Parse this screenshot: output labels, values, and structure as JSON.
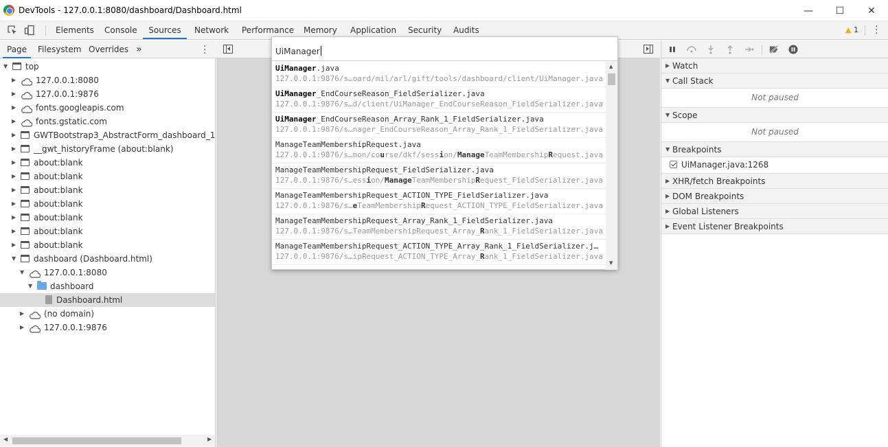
{
  "window": {
    "title": "DevTools - 127.0.0.1:8080/dashboard/Dashboard.html",
    "minimize": "—",
    "maximize": "☐",
    "close": "✕"
  },
  "toolbar": {
    "inspect_icon": "inspect-element-icon",
    "device_icon": "device-toolbar-icon",
    "tabs": [
      "Elements",
      "Console",
      "Sources",
      "Network",
      "Performance",
      "Memory",
      "Application",
      "Security",
      "Audits"
    ],
    "active_tab": "Sources",
    "warning_count": "1"
  },
  "navigator": {
    "tabs": [
      "Page",
      "Filesystem",
      "Overrides"
    ],
    "more": "»",
    "tree": [
      {
        "label": "top",
        "icon": "frame-icon",
        "expanded": true,
        "depth": 0
      },
      {
        "label": "127.0.0.1:8080",
        "icon": "cloud-icon",
        "expanded": false,
        "depth": 1
      },
      {
        "label": "127.0.0.1:9876",
        "icon": "cloud-icon",
        "expanded": false,
        "depth": 1
      },
      {
        "label": "fonts.googleapis.com",
        "icon": "cloud-icon",
        "expanded": false,
        "depth": 1
      },
      {
        "label": "fonts.gstatic.com",
        "icon": "cloud-icon",
        "expanded": false,
        "depth": 1
      },
      {
        "label": "GWTBootstrap3_AbstractForm_dashboard_1 (about:blank)",
        "icon": "frame-icon",
        "expanded": false,
        "depth": 1
      },
      {
        "label": "__gwt_historyFrame (about:blank)",
        "icon": "frame-icon",
        "expanded": false,
        "depth": 1
      },
      {
        "label": "about:blank",
        "icon": "frame-icon",
        "expanded": false,
        "depth": 1
      },
      {
        "label": "about:blank",
        "icon": "frame-icon",
        "expanded": false,
        "depth": 1
      },
      {
        "label": "about:blank",
        "icon": "frame-icon",
        "expanded": false,
        "depth": 1
      },
      {
        "label": "about:blank",
        "icon": "frame-icon",
        "expanded": false,
        "depth": 1
      },
      {
        "label": "about:blank",
        "icon": "frame-icon",
        "expanded": false,
        "depth": 1
      },
      {
        "label": "about:blank",
        "icon": "frame-icon",
        "expanded": false,
        "depth": 1
      },
      {
        "label": "about:blank",
        "icon": "frame-icon",
        "expanded": false,
        "depth": 1
      },
      {
        "label": "dashboard (Dashboard.html)",
        "icon": "frame-icon",
        "expanded": true,
        "depth": 1
      },
      {
        "label": "127.0.0.1:8080",
        "icon": "cloud-icon",
        "expanded": true,
        "depth": 2
      },
      {
        "label": "dashboard",
        "icon": "folder-icon",
        "expanded": true,
        "depth": 3
      },
      {
        "label": "Dashboard.html",
        "icon": "file-icon",
        "expanded": null,
        "depth": 4,
        "selected": true
      },
      {
        "label": "(no domain)",
        "icon": "cloud-icon",
        "expanded": false,
        "depth": 2
      },
      {
        "label": "127.0.0.1:9876",
        "icon": "cloud-icon",
        "expanded": false,
        "depth": 2
      }
    ]
  },
  "quick_open": {
    "query": "UiManager",
    "items": [
      {
        "name_html": "<b>UiManager</b>.java",
        "path_html": "127.0.0.1:9876/s…oard/mil/arl/gift/tools/dashboard/client/UiManager.java"
      },
      {
        "name_html": "<b>UiManager</b>_EndCourseReason_FieldSerializer.java",
        "path_html": "127.0.0.1:9876/s…d/client/UiManager_EndCourseReason_FieldSerializer.java"
      },
      {
        "name_html": "<b>UiManager</b>_EndCourseReason_Array_Rank_1_FieldSerializer.java",
        "path_html": "127.0.0.1:9876/s…nager_EndCourseReason_Array_Rank_1_FieldSerializer.java"
      },
      {
        "name_html": "ManageTeamMembershipRequest.java",
        "path_html": "127.0.0.1:9876/s…mon/co<b>u</b>rse/dkf/sess<b>i</b>on/<b>Manage</b>TeamMembership<b>R</b>equest.java"
      },
      {
        "name_html": "ManageTeamMembershipRequest_FieldSerializer.java",
        "path_html": "127.0.0.1:9876/s…ess<b>i</b>on/<b>Manage</b>TeamMembership<b>R</b>equest_FieldSerializer.java"
      },
      {
        "name_html": "ManageTeamMembershipRequest_ACTION_TYPE_FieldSerializer.java",
        "path_html": "127.0.0.1:9876/s…<b>e</b>TeamMembership<b>R</b>equest_ACTION_TYPE_FieldSerializer.java"
      },
      {
        "name_html": "ManageTeamMembershipRequest_Array_Rank_1_FieldSerializer.java",
        "path_html": "127.0.0.1:9876/s…TeamMembershipRequest_Array_<b>R</b>ank_1_FieldSerializer.java"
      },
      {
        "name_html": "ManageTeamMembershipRequest_ACTION_TYPE_Array_Rank_1_FieldSerializer.j…",
        "path_html": "127.0.0.1:9876/s…ipRequest_ACTION_TYPE_Array_<b>R</b>ank_1_FieldSerializer.java"
      }
    ]
  },
  "debugger": {
    "controls": [
      "pause-icon",
      "step-over-icon",
      "step-into-icon",
      "step-out-icon",
      "step-icon",
      "deactivate-breakpoints-icon",
      "pause-on-exceptions-icon"
    ],
    "panes": {
      "watch": "Watch",
      "call_stack": "Call Stack",
      "call_stack_status": "Not paused",
      "scope": "Scope",
      "scope_status": "Not paused",
      "breakpoints": "Breakpoints",
      "breakpoint_item": "UiManager.java:1268",
      "xhr": "XHR/fetch Breakpoints",
      "dom": "DOM Breakpoints",
      "global": "Global Listeners",
      "event": "Event Listener Breakpoints"
    }
  },
  "colors": {
    "accent": "#1a73e8",
    "warning": "#f2b100",
    "panel_bg": "#f3f3f3",
    "editor_bg": "#d7d7d7"
  }
}
